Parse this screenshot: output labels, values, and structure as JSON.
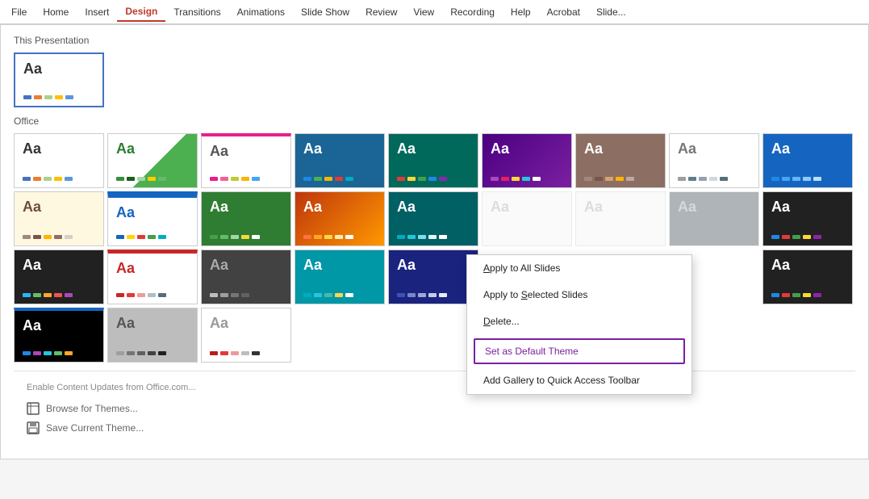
{
  "menuBar": {
    "items": [
      {
        "label": "File",
        "active": false
      },
      {
        "label": "Home",
        "active": false
      },
      {
        "label": "Insert",
        "active": false
      },
      {
        "label": "Design",
        "active": true
      },
      {
        "label": "Transitions",
        "active": false
      },
      {
        "label": "Animations",
        "active": false
      },
      {
        "label": "Slide Show",
        "active": false
      },
      {
        "label": "Review",
        "active": false
      },
      {
        "label": "View",
        "active": false
      },
      {
        "label": "Recording",
        "active": false
      },
      {
        "label": "Help",
        "active": false
      },
      {
        "label": "Acrobat",
        "active": false
      },
      {
        "label": "Slide...",
        "active": false
      }
    ]
  },
  "panel": {
    "thisPresentationLabel": "This Presentation",
    "officeLabel": "Office",
    "enableLink": "Enable Content Updates from Office.com...",
    "browseLink": "Browse for Themes...",
    "saveLink": "Save Current Theme..."
  },
  "contextMenu": {
    "items": [
      {
        "label": "Apply to All Slides",
        "underline": "A",
        "highlighted": false
      },
      {
        "label": "Apply to Selected Slides",
        "underline": "S",
        "highlighted": false
      },
      {
        "label": "Delete...",
        "underline": "D",
        "highlighted": false
      },
      {
        "label": "Set as Default Theme",
        "highlighted": true
      },
      {
        "label": "Add Gallery to Quick Access Toolbar",
        "highlighted": false
      }
    ]
  }
}
